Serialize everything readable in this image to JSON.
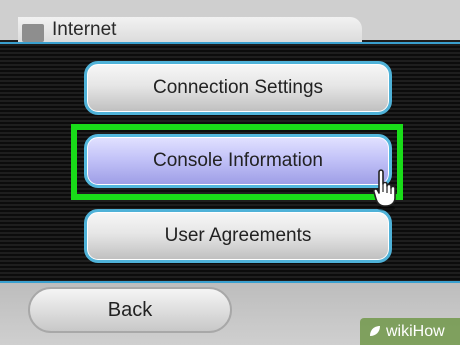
{
  "header": {
    "title": "Internet"
  },
  "menu": {
    "items": [
      {
        "label": "Connection Settings"
      },
      {
        "label": "Console Information"
      },
      {
        "label": "User Agreements"
      }
    ],
    "selected_index": 1
  },
  "footer": {
    "back_label": "Back"
  },
  "watermark": {
    "text": "wikiHow"
  },
  "colors": {
    "accent_line": "#3aa0cf",
    "highlight": "#19dc19",
    "selected_button": "#c3c3f8"
  },
  "icons": {
    "cursor": "pointing-hand-icon",
    "title_marker": "square-icon"
  }
}
